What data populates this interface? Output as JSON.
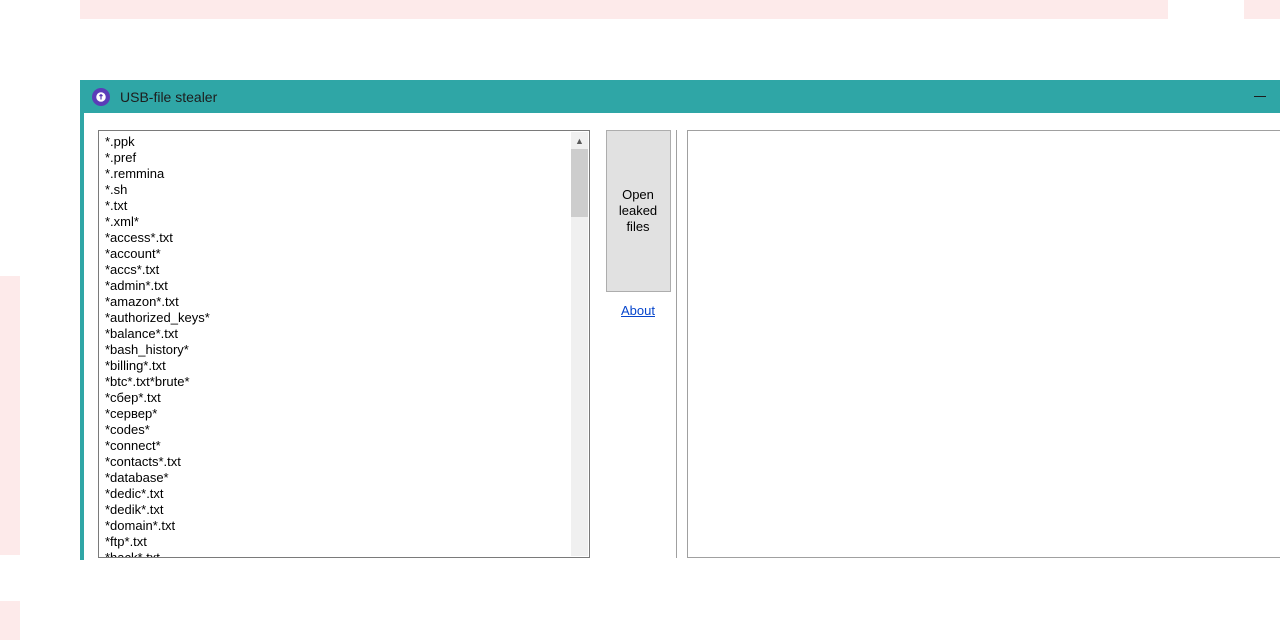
{
  "window": {
    "title": "USB-file stealer",
    "list_text": "*.ppk\n*.pref\n*.remmina\n*.sh\n*.txt\n*.xml*\n*access*.txt\n*account*\n*accs*.txt\n*admin*.txt\n*amazon*.txt\n*authorized_keys*\n*balance*.txt\n*bash_history*\n*billing*.txt\n*btc*.txt*brute*\n*сбер*.txt\n*сервер*\n*codes*\n*connect*\n*contacts*.txt\n*database*\n*dedic*.txt\n*dedik*.txt\n*domain*.txt\n*ftp*.txt\n*hack*.txt",
    "open_btn_line1": "Open",
    "open_btn_line2": "leaked",
    "open_btn_line3": "files",
    "about_label": "About"
  }
}
